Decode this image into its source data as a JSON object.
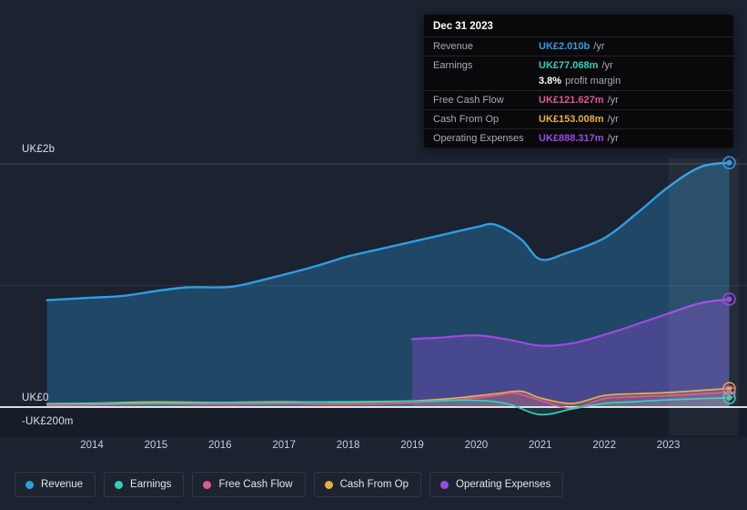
{
  "tooltip": {
    "date": "Dec 31 2023",
    "rows": [
      {
        "label": "Revenue",
        "value": "UK£2.010b",
        "suffix": "/yr",
        "color": "#2f9ee3"
      },
      {
        "label": "Earnings",
        "value": "UK£77.068m",
        "suffix": "/yr",
        "color": "#35d0ba"
      },
      {
        "label": "",
        "value": "3.8%",
        "suffix": "profit margin",
        "color": "#ffffff"
      },
      {
        "label": "Free Cash Flow",
        "value": "UK£121.627m",
        "suffix": "/yr",
        "color": "#e0569a"
      },
      {
        "label": "Cash From Op",
        "value": "UK£153.008m",
        "suffix": "/yr",
        "color": "#e8b041"
      },
      {
        "label": "Operating Expenses",
        "value": "UK£888.317m",
        "suffix": "/yr",
        "color": "#9b4ae0"
      }
    ]
  },
  "axis": {
    "y_top_label": "UK£2b",
    "y_zero_label": "UK£0",
    "y_neg_label": "-UK£200m",
    "x_labels": [
      "2014",
      "2015",
      "2016",
      "2017",
      "2018",
      "2019",
      "2020",
      "2021",
      "2022",
      "2023"
    ]
  },
  "legend": {
    "items": [
      {
        "label": "Revenue",
        "color": "#2f9ee3"
      },
      {
        "label": "Earnings",
        "color": "#35d0ba"
      },
      {
        "label": "Free Cash Flow",
        "color": "#e0569a"
      },
      {
        "label": "Cash From Op",
        "color": "#e8b041"
      },
      {
        "label": "Operating Expenses",
        "color": "#9b4ae0"
      }
    ]
  },
  "chart_data": {
    "type": "area",
    "unit": "UK£ millions",
    "x_axis": {
      "ticks": [
        "2014",
        "2015",
        "2016",
        "2017",
        "2018",
        "2019",
        "2020",
        "2021",
        "2022",
        "2023"
      ],
      "range": [
        2013.3,
        2024.1
      ]
    },
    "y_axis": {
      "tick_labels": [
        "-UK£200m",
        "UK£0",
        "UK£2b"
      ],
      "tick_values_m": [
        -200,
        0,
        2000
      ],
      "range_m": [
        -240,
        2100
      ]
    },
    "highlight_band_x": [
      2023.0,
      2024.1
    ],
    "grid": true,
    "legend_position": "bottom",
    "series": [
      {
        "name": "Revenue",
        "color": "#2f9ee3",
        "fill_opacity": 0.3,
        "line_width": 2.4,
        "x": [
          2013.3,
          2014,
          2014.5,
          2015,
          2015.5,
          2016,
          2016.3,
          2017,
          2017.5,
          2018,
          2018.5,
          2019,
          2019.5,
          2020,
          2020.3,
          2020.7,
          2021,
          2021.4,
          2022,
          2022.5,
          2023,
          2023.5,
          2023.95
        ],
        "values": [
          880,
          900,
          915,
          955,
          985,
          985,
          1000,
          1090,
          1160,
          1240,
          1300,
          1360,
          1420,
          1480,
          1500,
          1380,
          1215,
          1265,
          1390,
          1590,
          1810,
          1975,
          2010
        ]
      },
      {
        "name": "Operating Expenses",
        "color": "#9b4ae0",
        "fill_opacity": 0.32,
        "line_width": 2.2,
        "x": [
          2019,
          2019.4,
          2020,
          2020.5,
          2021,
          2021.5,
          2022,
          2022.5,
          2023,
          2023.5,
          2023.95
        ],
        "values": [
          560,
          570,
          590,
          555,
          505,
          525,
          595,
          680,
          770,
          855,
          888
        ]
      },
      {
        "name": "Cash From Op",
        "color": "#e8b041",
        "fill_opacity": 0.18,
        "line_width": 1.7,
        "x": [
          2013.3,
          2014,
          2015,
          2016,
          2017,
          2018,
          2019,
          2019.6,
          2020.3,
          2020.7,
          2021,
          2021.5,
          2022,
          2022.5,
          2023,
          2023.95
        ],
        "values": [
          28,
          32,
          42,
          38,
          44,
          38,
          50,
          70,
          110,
          130,
          75,
          30,
          95,
          110,
          120,
          153
        ]
      },
      {
        "name": "Free Cash Flow",
        "color": "#e0569a",
        "fill_opacity": 0.15,
        "line_width": 1.7,
        "x": [
          2013.3,
          2014,
          2015,
          2016,
          2017,
          2018,
          2019,
          2019.6,
          2020.3,
          2020.6,
          2021,
          2021.5,
          2022,
          2022.5,
          2023,
          2023.95
        ],
        "values": [
          12,
          18,
          28,
          22,
          28,
          22,
          35,
          55,
          95,
          115,
          55,
          -10,
          70,
          85,
          95,
          122
        ]
      },
      {
        "name": "Earnings",
        "color": "#35d0ba",
        "fill_opacity": 0.15,
        "line_width": 1.7,
        "x": [
          2013.3,
          2014,
          2015,
          2016,
          2017,
          2018,
          2019,
          2020,
          2020.5,
          2021,
          2021.5,
          2022,
          2022.5,
          2023,
          2023.95
        ],
        "values": [
          25,
          28,
          33,
          36,
          40,
          44,
          50,
          55,
          25,
          -62,
          -15,
          30,
          45,
          60,
          77
        ]
      }
    ]
  }
}
